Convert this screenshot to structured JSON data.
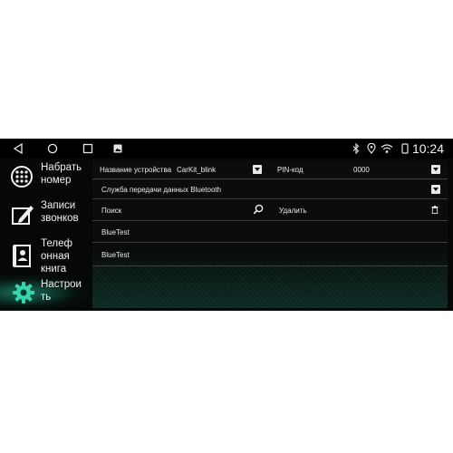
{
  "status_bar": {
    "nav_icons": [
      "back-icon",
      "home-icon",
      "recents-icon",
      "gallery-icon"
    ],
    "status_icons": [
      "bluetooth-icon",
      "location-icon",
      "wifi-icon",
      "tablet-icon"
    ],
    "time": "10:24"
  },
  "sidebar": {
    "items": [
      {
        "label": "Набрать\nномер",
        "icon": "dialpad-icon"
      },
      {
        "label": "Записи\nзвонков",
        "icon": "call-log-icon"
      },
      {
        "label": "Телеф\nонная\nкнига",
        "icon": "phonebook-icon"
      },
      {
        "label": "Настрои\nть",
        "icon": "settings-gear-icon",
        "active": true
      }
    ],
    "active_color": "#2fc9a0"
  },
  "settings": {
    "device_name_label": "Название устройства",
    "device_name_value": "CarKit_blink",
    "pin_label": "PIN-код",
    "pin_value": "0000",
    "bluetooth_service_label": "Служба передачи данных Bluetooth",
    "search_label": "Поиск",
    "delete_label": "Удалить",
    "devices": [
      "BlueTest",
      "BlueTest"
    ]
  }
}
